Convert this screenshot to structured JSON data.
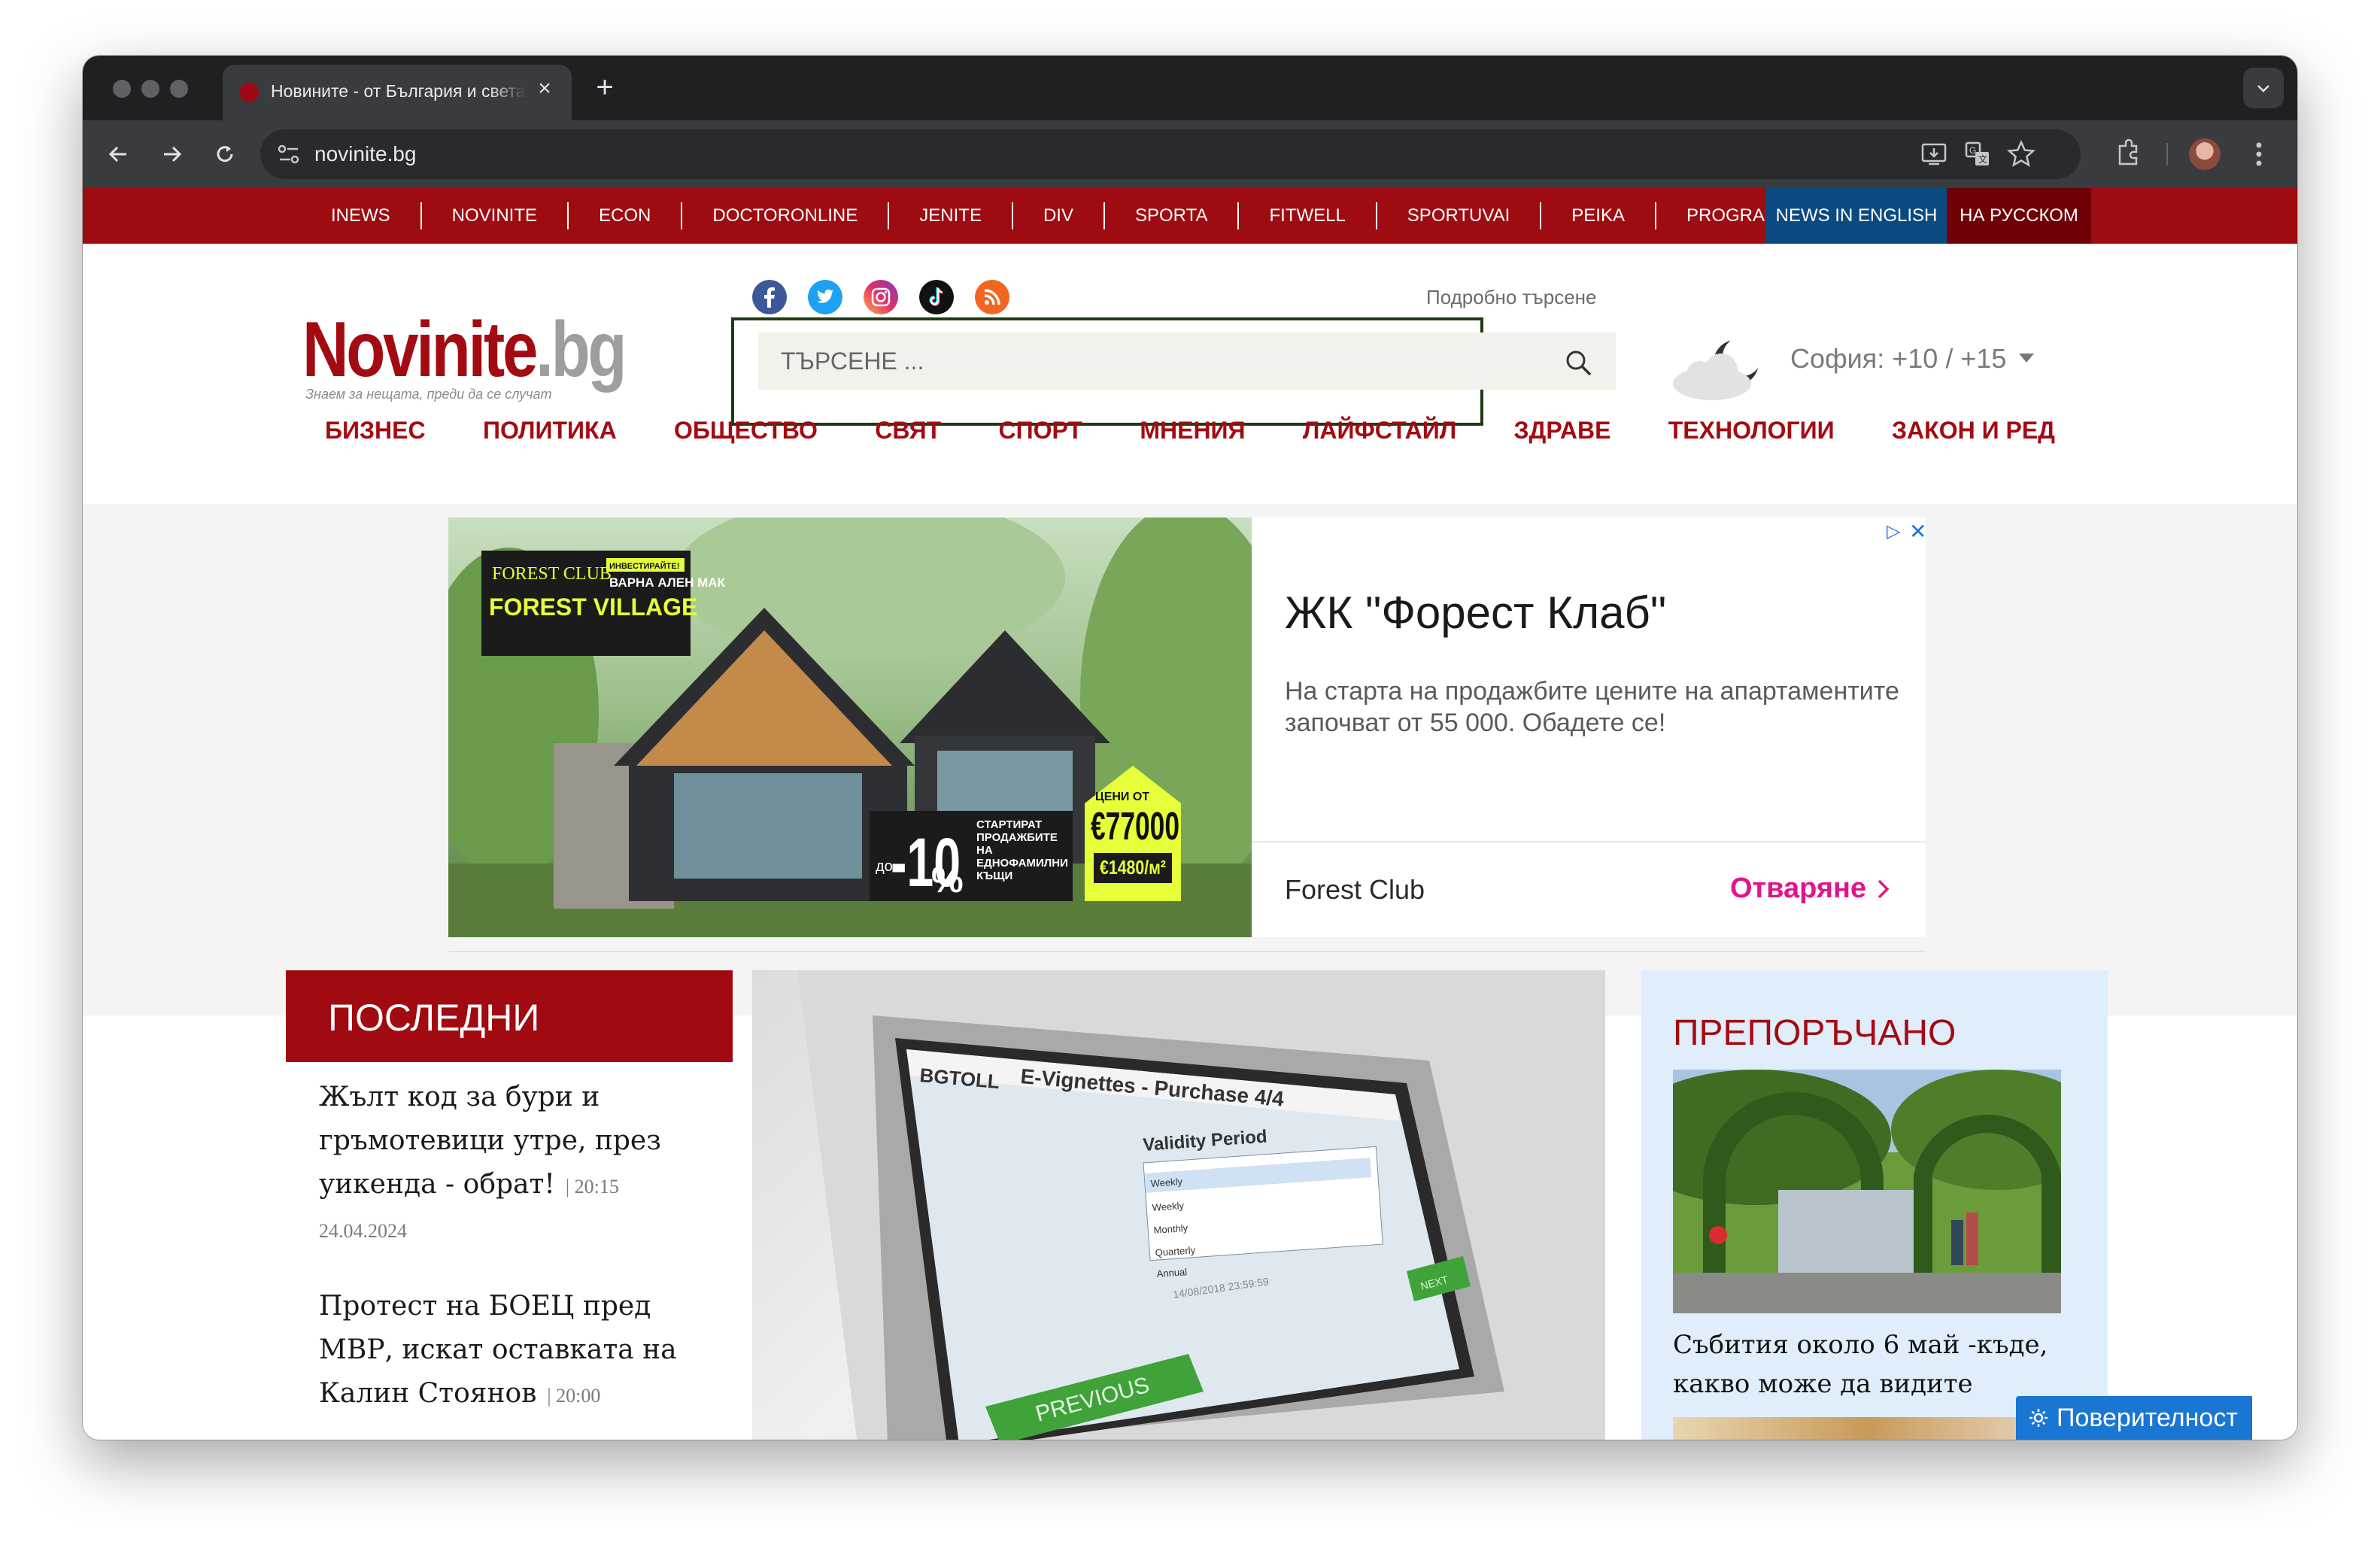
{
  "browser": {
    "tab_title": "Новините - от България и света",
    "url": "novinite.bg"
  },
  "topnav": {
    "items": [
      "INEWS",
      "NOVINITE",
      "ECON",
      "DOCTORONLINE",
      "JENITE",
      "DIV",
      "SPORTA",
      "FITWELL",
      "SPORTUVAI",
      "PEIKA",
      "PROGRAMATA"
    ],
    "english": "NEWS IN ENGLISH",
    "russian": "НА РУССКОМ",
    "english_color": "#0b4a80",
    "russian_color": "#6e0006"
  },
  "header": {
    "logo_main": "Novinite",
    "logo_suffix": ".bg",
    "logo_tagline": "Знаем за нещата, преди да се случат",
    "social_icons": [
      "facebook-icon",
      "twitter-icon",
      "instagram-icon",
      "tiktok-icon",
      "rss-icon"
    ],
    "advanced_search": "Подробно търсене",
    "search_placeholder": "ТЪРСЕНЕ ...",
    "weather": "София: +10 / +15"
  },
  "categories": [
    "БИЗНЕС",
    "ПОЛИТИКА",
    "ОБЩЕСТВО",
    "СВЯТ",
    "СПОРТ",
    "МНЕНИЯ",
    "ЛАЙФСТАЙЛ",
    "ЗДРАВЕ",
    "ТЕХНОЛОГИИ",
    "ЗАКОН И РЕД"
  ],
  "ad": {
    "title": "ЖК \"Форест Клаб\"",
    "description": "На старта на продажбите цените на апартаментите започват от 55 000. Обадете се!",
    "brand": "Forest Club",
    "cta": "Отваряне",
    "image_text": {
      "badge": "ИНВЕСТИРАЙТЕ!",
      "location": "ВАРНА АЛЕН МАК",
      "club": "FOREST CLUB",
      "village": "FOREST VILLAGE",
      "discount_prefix": "до",
      "discount": "-10",
      "discount_percent": "%",
      "discount_note": "СТАРТИРАТ ПРОДАЖБИТЕ НА ЕДНОФАМИЛНИ КЪЩИ",
      "price_label": "ЦЕНИ ОТ",
      "price": "€77000",
      "price_sqm": "€1480/м²"
    }
  },
  "latest": {
    "title": "ПОСЛЕДНИ",
    "items": [
      {
        "headline": "Жълт код за бури и гръмотевици утре, през уикенда - обрат!",
        "time": "| 20:15",
        "date": "24.04.2024"
      },
      {
        "headline": "Протест на БОЕЦ пред МВР, искат оставката на Калин Стоянов",
        "time": "| 20:00"
      }
    ]
  },
  "hero": {
    "screen_brand": "BGTOLL",
    "screen_title": "E-Vignettes - Purchase 4/4",
    "screen_heading": "Validity Period",
    "screen_options": [
      "Weekly",
      "Weekly",
      "Monthly",
      "Quarterly",
      "Annual"
    ],
    "screen_date": "14/08/2018 23:59:59",
    "previous_button": "PREVIOUS",
    "next_button": "NEXT"
  },
  "recommended": {
    "title": "ПРЕПОРЪЧАНО",
    "headline": "Събития около 6 май -къде, какво може да видите"
  },
  "privacy": {
    "label": "Поверителност"
  }
}
